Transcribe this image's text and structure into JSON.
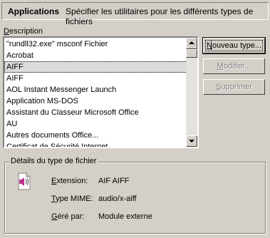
{
  "header": {
    "title": "Applications",
    "subtitle": "Spécifier les utilitaires pour les différents types de fichiers"
  },
  "description_label": {
    "accel": "D",
    "rest": "escription"
  },
  "list": {
    "items": [
      "\"rundll32.exe\" msconf Fichier",
      "Acrobat",
      "AIFF",
      "AIFF",
      "AOL Instant Messenger Launch",
      "Application MS-DOS",
      "Assistant du Classeur Microsoft Office",
      "AU",
      "Autres documents Office...",
      "Certificat de Sécurité Internet"
    ],
    "selected_index": 2
  },
  "buttons": {
    "new": {
      "accel": "N",
      "rest": "ouveau type..."
    },
    "modify": {
      "pre": "",
      "accel": "M",
      "rest": "odifier..."
    },
    "delete": {
      "pre": "",
      "accel": "S",
      "rest": "upprimer"
    }
  },
  "details": {
    "group_title": "Détails du type de fichier",
    "extension_label": {
      "accel": "E",
      "rest": "xtension:"
    },
    "extension_value": "AIF AIFF",
    "mime_label": {
      "accel": "T",
      "rest": "ype MIME:"
    },
    "mime_value": "audio/x-aiff",
    "handled_label": {
      "accel": "G",
      "rest": "éré par:"
    },
    "handled_value": "Module externe",
    "icon": "audio-file-icon"
  },
  "colors": {
    "window_bg": "#d4d0c8",
    "selection_bg": "#dcdcdc",
    "icon_accent": "#c0338a"
  }
}
